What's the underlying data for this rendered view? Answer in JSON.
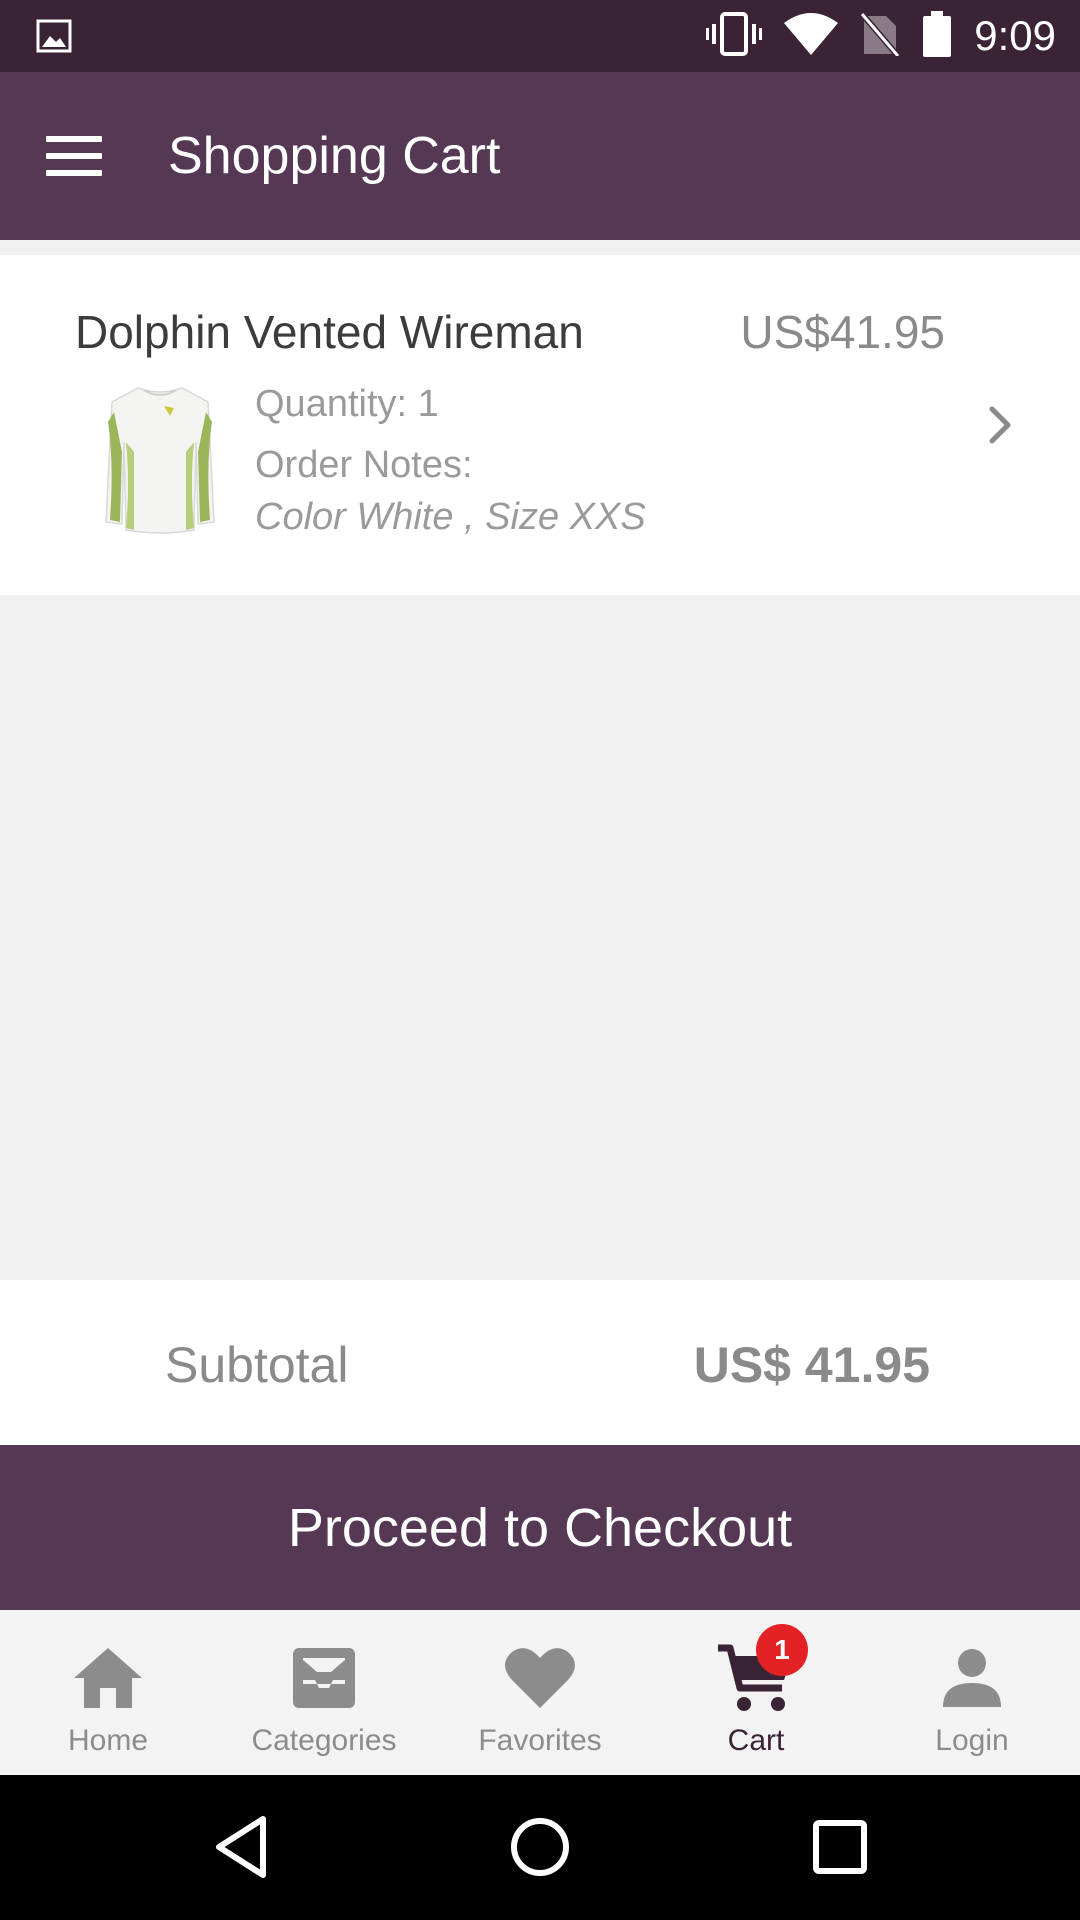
{
  "status_bar": {
    "time": "9:09"
  },
  "app_bar": {
    "title": "Shopping Cart"
  },
  "cart_item": {
    "name": "Dolphin Vented Wireman",
    "price": "US$41.95",
    "quantity": "Quantity: 1",
    "notes_label": "Order Notes:",
    "notes": "Color White , Size XXS"
  },
  "subtotal": {
    "label": "Subtotal",
    "value": "US$ 41.95"
  },
  "checkout": {
    "label": "Proceed to Checkout"
  },
  "bottom_nav": {
    "items": [
      {
        "label": "Home",
        "icon": "home-icon"
      },
      {
        "label": "Categories",
        "icon": "categories-icon"
      },
      {
        "label": "Favorites",
        "icon": "heart-icon"
      },
      {
        "label": "Cart",
        "icon": "cart-icon",
        "badge": "1"
      },
      {
        "label": "Login",
        "icon": "person-icon"
      }
    ],
    "active_index": 3
  },
  "colors": {
    "status_bar": "#3a2334",
    "primary": "#553853",
    "badge": "#e32226",
    "muted_text": "#8a8a8a"
  }
}
